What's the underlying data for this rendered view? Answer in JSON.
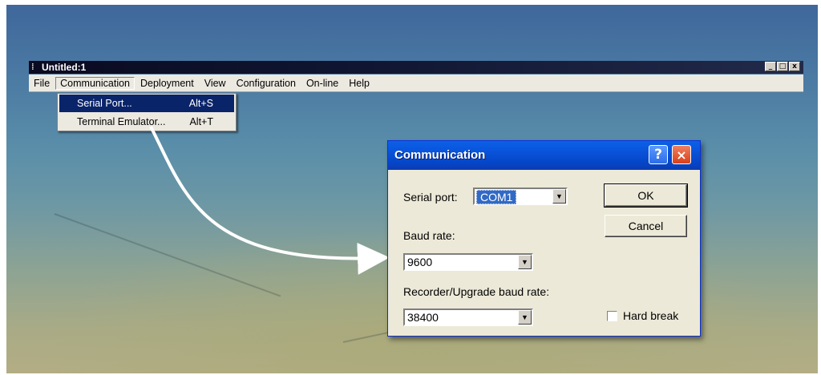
{
  "app": {
    "title": "Untitled:1",
    "window_controls": [
      "_",
      "□",
      "x"
    ]
  },
  "menubar": {
    "items": [
      {
        "label": "File"
      },
      {
        "label": "Communication"
      },
      {
        "label": "Deployment"
      },
      {
        "label": "View"
      },
      {
        "label": "Configuration"
      },
      {
        "label": "On-line"
      },
      {
        "label": "Help"
      }
    ]
  },
  "dropdown": {
    "items": [
      {
        "label": "Serial Port...",
        "shortcut": "Alt+S",
        "highlighted": true
      },
      {
        "label": "Terminal Emulator...",
        "shortcut": "Alt+T",
        "highlighted": false
      }
    ]
  },
  "dialog": {
    "title": "Communication",
    "help_label": "?",
    "close_label": "×",
    "serial_port_label": "Serial port:",
    "serial_port_value": "COM1",
    "baud_rate_label": "Baud rate:",
    "baud_rate_value": "9600",
    "recorder_baud_label": "Recorder/Upgrade baud rate:",
    "recorder_baud_value": "38400",
    "ok_label": "OK",
    "cancel_label": "Cancel",
    "hard_break_label": "Hard break",
    "hard_break_checked": false
  },
  "colors": {
    "titlebar_blue": "#0a58e0",
    "selection_blue": "#0a246a",
    "close_red": "#d8401a",
    "callout_arrow": "#ffffff"
  }
}
